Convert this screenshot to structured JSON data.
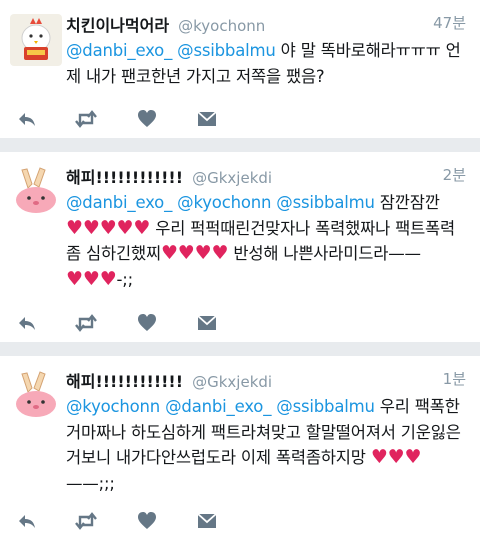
{
  "colors": {
    "mention": "#1b95e0",
    "heart": "#e0245e",
    "meta": "#8899a6",
    "action": "#657786"
  },
  "tweets": [
    {
      "author_name": "치킨이나먹어라",
      "handle": "@kyochonn",
      "time": "47분",
      "mentions": [
        "@danbi_exo_",
        "@ssibbalmu"
      ],
      "text": "야 말 똑바로해라ㅠㅠㅠ 언제 내가 팬코한년 가지고 저쪽을 팼음?"
    },
    {
      "author_name": "해피!!!!!!!!!!!!",
      "handle": "@Gkxjekdi",
      "time": "2분",
      "mentions": [
        "@danbi_exo_",
        "@kyochonn",
        "@ssibbalmu"
      ],
      "segments": [
        "잠깐잠깐",
        "우리 퍽퍽때린건맞자나 폭력했짜나 팩트폭력 좀 심하긴했찌",
        "반성해 나쁜사라미드라——",
        "-;;"
      ]
    },
    {
      "author_name": "해피!!!!!!!!!!!!",
      "handle": "@Gkxjekdi",
      "time": "1분",
      "mentions": [
        "@kyochonn",
        "@danbi_exo_",
        "@ssibbalmu"
      ],
      "segments": [
        "우리 팩폭한거마짜나 하도심하게 팩트라쳐맞고 할말떨어져서 기운잃은거보니 내가다안쓰럽도라 이제 폭력좀하지망",
        "——;;;"
      ]
    }
  ],
  "action_icons": [
    "reply-icon",
    "retweet-icon",
    "heart-icon",
    "dm-icon"
  ]
}
